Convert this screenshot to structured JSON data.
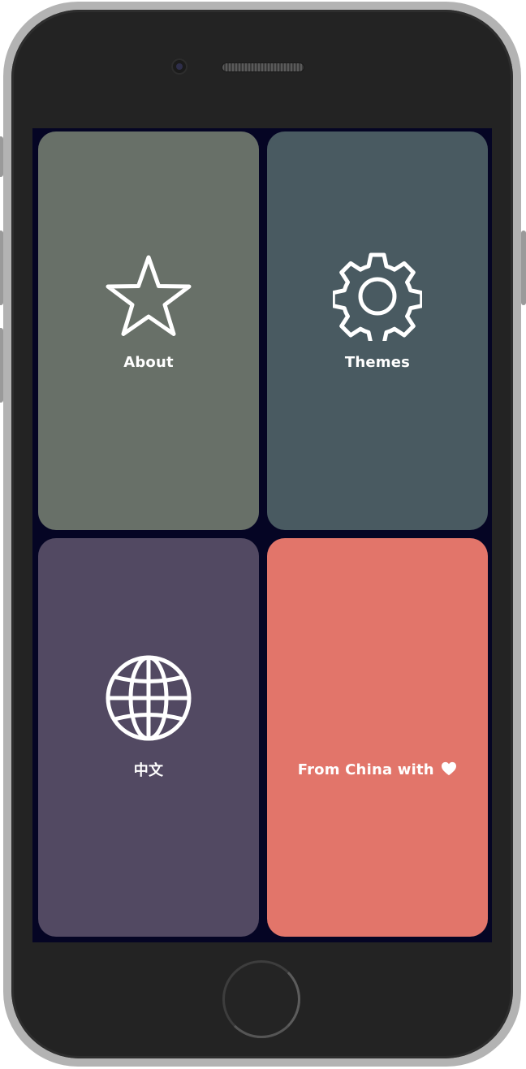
{
  "tiles": [
    {
      "id": "about",
      "label": "About",
      "icon": "star-icon",
      "color": "#687068"
    },
    {
      "id": "themes",
      "label": "Themes",
      "icon": "gear-icon",
      "color": "#495a61"
    },
    {
      "id": "language",
      "label": "中文",
      "icon": "globe-icon",
      "color": "#524962"
    },
    {
      "id": "credits",
      "label": "From China with",
      "icon": "heart-icon",
      "color": "#e2756a"
    }
  ],
  "colors": {
    "screen_background": "#050524",
    "device_frame": "#232323",
    "device_bezel": "#b3b3b3",
    "text": "#ffffff"
  }
}
